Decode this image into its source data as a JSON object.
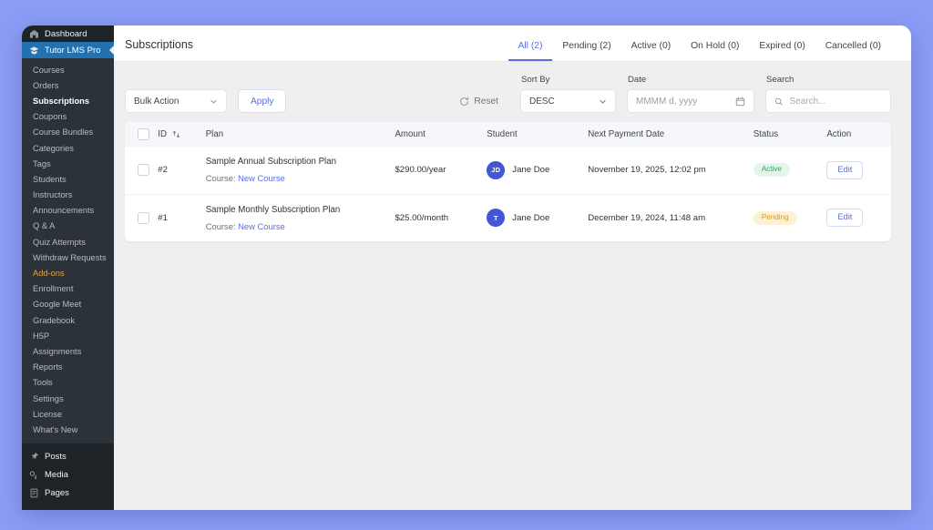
{
  "theme": {
    "desktop_bg": "#8b9cf7",
    "sidebar_bg": "#1d2327",
    "sidebar_sub_bg": "#2c3338",
    "accent": "#5b6fe0",
    "active_nav_bg": "#2271b1",
    "addon_color": "#e8a33d",
    "content_bg": "#efefef",
    "status_active": "#3d9e63",
    "status_pending": "#d79a26",
    "avatar_bg": "#4356d6"
  },
  "sidebar": {
    "top_items": [
      {
        "label": "Dashboard",
        "icon": "dashboard-icon",
        "active": false
      },
      {
        "label": "Tutor LMS Pro",
        "icon": "tutor-graduation-icon",
        "active": true
      }
    ],
    "sub_items": [
      {
        "label": "Courses",
        "state": "normal"
      },
      {
        "label": "Orders",
        "state": "normal"
      },
      {
        "label": "Subscriptions",
        "state": "current"
      },
      {
        "label": "Coupons",
        "state": "normal"
      },
      {
        "label": "Course Bundles",
        "state": "normal"
      },
      {
        "label": "Categories",
        "state": "normal"
      },
      {
        "label": "Tags",
        "state": "normal"
      },
      {
        "label": "Students",
        "state": "normal"
      },
      {
        "label": "Instructors",
        "state": "normal"
      },
      {
        "label": "Announcements",
        "state": "normal"
      },
      {
        "label": "Q & A",
        "state": "normal"
      },
      {
        "label": "Quiz Attempts",
        "state": "normal"
      },
      {
        "label": "Withdraw Requests",
        "state": "normal"
      },
      {
        "label": "Add-ons",
        "state": "addon"
      },
      {
        "label": "Enrollment",
        "state": "normal"
      },
      {
        "label": "Google Meet",
        "state": "normal"
      },
      {
        "label": "Gradebook",
        "state": "normal"
      },
      {
        "label": "H5P",
        "state": "normal"
      },
      {
        "label": "Assignments",
        "state": "normal"
      },
      {
        "label": "Reports",
        "state": "normal"
      },
      {
        "label": "Tools",
        "state": "normal"
      },
      {
        "label": "Settings",
        "state": "normal"
      },
      {
        "label": "License",
        "state": "normal"
      },
      {
        "label": "What's New",
        "state": "normal"
      }
    ],
    "bottom_items": [
      {
        "label": "Posts",
        "icon": "pin-icon"
      },
      {
        "label": "Media",
        "icon": "media-icon"
      },
      {
        "label": "Pages",
        "icon": "pages-icon"
      }
    ]
  },
  "header": {
    "title": "Subscriptions",
    "tabs": [
      {
        "label": "All (2)",
        "selected": true
      },
      {
        "label": "Pending (2)",
        "selected": false
      },
      {
        "label": "Active (0)",
        "selected": false
      },
      {
        "label": "On Hold (0)",
        "selected": false
      },
      {
        "label": "Expired (0)",
        "selected": false
      },
      {
        "label": "Cancelled (0)",
        "selected": false
      }
    ]
  },
  "filters": {
    "bulk_action_value": "Bulk Action",
    "apply_label": "Apply",
    "reset_label": "Reset",
    "sort_by_label": "Sort By",
    "sort_by_value": "DESC",
    "date_label": "Date",
    "date_placeholder": "MMMM d, yyyy",
    "search_label": "Search",
    "search_placeholder": "Search...",
    "search_value": ""
  },
  "table": {
    "columns": [
      "ID",
      "Plan",
      "Amount",
      "Student",
      "Next Payment Date",
      "Status",
      "Action"
    ],
    "rows": [
      {
        "id": "#2",
        "plan_title": "Sample Annual Subscription Plan",
        "course_prefix": "Course:",
        "course_name": "New Course",
        "amount": "$290.00/year",
        "student_initials": "JD",
        "student_name": "Jane Doe",
        "next_payment": "November 19, 2025, 12:02 pm",
        "status": "Active",
        "status_kind": "active",
        "action": "Edit"
      },
      {
        "id": "#1",
        "plan_title": "Sample Monthly Subscription Plan",
        "course_prefix": "Course:",
        "course_name": "New Course",
        "amount": "$25.00/month",
        "student_initials": "T",
        "student_name": "Jane Doe",
        "next_payment": "December 19, 2024, 11:48 am",
        "status": "Pending",
        "status_kind": "pending",
        "action": "Edit"
      }
    ]
  }
}
